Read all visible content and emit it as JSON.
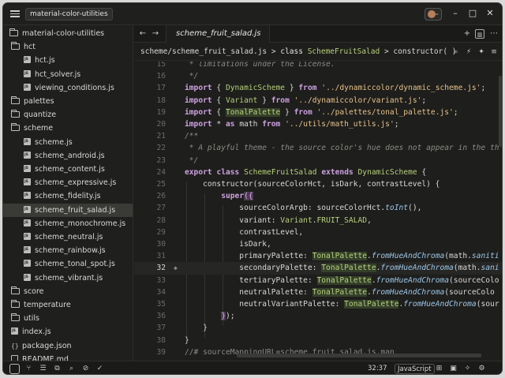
{
  "titlebar": {
    "project": "material-color-utilities",
    "controls": {
      "minimize": "–",
      "maximize": "□",
      "close": "✕"
    }
  },
  "sidebar": {
    "items": [
      {
        "label": "material-color-utilities",
        "kind": "folder-open",
        "depth": 0
      },
      {
        "label": "hct",
        "kind": "folder-open",
        "depth": 1
      },
      {
        "label": "hct.js",
        "kind": "js",
        "depth": 2
      },
      {
        "label": "hct_solver.js",
        "kind": "js",
        "depth": 2
      },
      {
        "label": "viewing_conditions.js",
        "kind": "js",
        "depth": 2
      },
      {
        "label": "palettes",
        "kind": "folder",
        "depth": 1
      },
      {
        "label": "quantize",
        "kind": "folder",
        "depth": 1
      },
      {
        "label": "scheme",
        "kind": "folder-open",
        "depth": 1
      },
      {
        "label": "scheme.js",
        "kind": "js",
        "depth": 2
      },
      {
        "label": "scheme_android.js",
        "kind": "js",
        "depth": 2
      },
      {
        "label": "scheme_content.js",
        "kind": "js",
        "depth": 2
      },
      {
        "label": "scheme_expressive.js",
        "kind": "js",
        "depth": 2
      },
      {
        "label": "scheme_fidelity.js",
        "kind": "js",
        "depth": 2
      },
      {
        "label": "scheme_fruit_salad.js",
        "kind": "js",
        "depth": 2,
        "selected": true
      },
      {
        "label": "scheme_monochrome.js",
        "kind": "js",
        "depth": 2
      },
      {
        "label": "scheme_neutral.js",
        "kind": "js",
        "depth": 2
      },
      {
        "label": "scheme_rainbow.js",
        "kind": "js",
        "depth": 2
      },
      {
        "label": "scheme_tonal_spot.js",
        "kind": "js",
        "depth": 2
      },
      {
        "label": "scheme_vibrant.js",
        "kind": "js",
        "depth": 2
      },
      {
        "label": "score",
        "kind": "folder",
        "depth": 1
      },
      {
        "label": "temperature",
        "kind": "folder",
        "depth": 1
      },
      {
        "label": "utils",
        "kind": "folder",
        "depth": 1
      },
      {
        "label": "index.js",
        "kind": "js",
        "depth": 1
      },
      {
        "label": "package.json",
        "kind": "json",
        "depth": 1
      },
      {
        "label": "README.md",
        "kind": "md",
        "depth": 1
      }
    ]
  },
  "editor": {
    "tab": "scheme_fruit_salad.js",
    "breadcrumb": {
      "path": "scheme/scheme_fruit_salad.js",
      "sep": ">",
      "keyword": "class",
      "class_name": "SchemeFruitSalad",
      "member": "constructor( )"
    }
  },
  "code": {
    "active_line": 32,
    "lines": [
      {
        "n": "15",
        "tokens": [
          [
            "c",
            " * limitations under the License."
          ]
        ]
      },
      {
        "n": "16",
        "tokens": [
          [
            "c",
            " */"
          ]
        ]
      },
      {
        "n": "17",
        "tokens": [
          [
            "k",
            "import"
          ],
          [
            "p",
            " { "
          ],
          [
            "t",
            "DynamicScheme"
          ],
          [
            "p",
            " } "
          ],
          [
            "k",
            "from"
          ],
          [
            "p",
            " "
          ],
          [
            "s",
            "'../dynamiccolor/dynamic_scheme.js'"
          ],
          [
            "p",
            ";"
          ]
        ]
      },
      {
        "n": "18",
        "tokens": [
          [
            "k",
            "import"
          ],
          [
            "p",
            " { "
          ],
          [
            "t",
            "Variant"
          ],
          [
            "p",
            " } "
          ],
          [
            "k",
            "from"
          ],
          [
            "p",
            " "
          ],
          [
            "s",
            "'../dynamiccolor/variant.js'"
          ],
          [
            "p",
            ";"
          ]
        ]
      },
      {
        "n": "19",
        "tokens": [
          [
            "k",
            "import"
          ],
          [
            "p",
            " { "
          ],
          [
            "th",
            "TonalPalette"
          ],
          [
            "p",
            " } "
          ],
          [
            "k",
            "from"
          ],
          [
            "p",
            " "
          ],
          [
            "s",
            "'../palettes/tonal_palette.js'"
          ],
          [
            "p",
            ";"
          ]
        ]
      },
      {
        "n": "20",
        "tokens": [
          [
            "k",
            "import"
          ],
          [
            "p",
            " * "
          ],
          [
            "k",
            "as"
          ],
          [
            "p",
            " math "
          ],
          [
            "k",
            "from"
          ],
          [
            "p",
            " "
          ],
          [
            "s",
            "'../utils/math_utils.js'"
          ],
          [
            "p",
            ";"
          ]
        ]
      },
      {
        "n": "21",
        "tokens": [
          [
            "c",
            "/**"
          ]
        ]
      },
      {
        "n": "22",
        "tokens": [
          [
            "c",
            " * A playful theme - the source color's hue does not appear in the th"
          ]
        ]
      },
      {
        "n": "23",
        "tokens": [
          [
            "c",
            " */"
          ]
        ]
      },
      {
        "n": "24",
        "tokens": [
          [
            "k",
            "export"
          ],
          [
            "p",
            " "
          ],
          [
            "k",
            "class"
          ],
          [
            "p",
            " "
          ],
          [
            "t",
            "SchemeFruitSalad"
          ],
          [
            "p",
            " "
          ],
          [
            "k",
            "extends"
          ],
          [
            "p",
            " "
          ],
          [
            "t",
            "DynamicScheme"
          ],
          [
            "p",
            " {"
          ]
        ]
      },
      {
        "n": "25",
        "tokens": [
          [
            "p",
            "    constructor(sourceColorHct, isDark, contrastLevel) {"
          ]
        ]
      },
      {
        "n": "26",
        "tokens": [
          [
            "p",
            "        "
          ],
          [
            "k",
            "super"
          ],
          [
            "br",
            "("
          ],
          [
            "br",
            "{"
          ]
        ]
      },
      {
        "n": "27",
        "tokens": [
          [
            "p",
            "            sourceColorArgb: sourceColorHct."
          ],
          [
            "f",
            "toInt"
          ],
          [
            "p",
            "(),"
          ]
        ]
      },
      {
        "n": "28",
        "tokens": [
          [
            "p",
            "            variant: "
          ],
          [
            "t",
            "Variant"
          ],
          [
            "p",
            "."
          ],
          [
            "t",
            "FRUIT_SALAD"
          ],
          [
            "p",
            ","
          ]
        ]
      },
      {
        "n": "29",
        "tokens": [
          [
            "p",
            "            contrastLevel,"
          ]
        ]
      },
      {
        "n": "30",
        "tokens": [
          [
            "p",
            "            isDark,"
          ]
        ]
      },
      {
        "n": "31",
        "tokens": [
          [
            "p",
            "            primaryPalette: "
          ],
          [
            "th",
            "TonalPalette"
          ],
          [
            "p",
            "."
          ],
          [
            "f",
            "fromHueAndChroma"
          ],
          [
            "p",
            "(math."
          ],
          [
            "f",
            "saniti"
          ]
        ]
      },
      {
        "n": "32",
        "tokens": [
          [
            "p",
            "            secondaryPalette: "
          ],
          [
            "th",
            "TonalPalette"
          ],
          [
            "p",
            "."
          ],
          [
            "f",
            "fromHueAndChroma"
          ],
          [
            "p",
            "(math."
          ],
          [
            "f",
            "sani"
          ]
        ]
      },
      {
        "n": "33",
        "tokens": [
          [
            "p",
            "            tertiaryPalette: "
          ],
          [
            "th",
            "TonalPalette"
          ],
          [
            "p",
            "."
          ],
          [
            "f",
            "fromHueAndChroma"
          ],
          [
            "p",
            "(sourceColo"
          ]
        ]
      },
      {
        "n": "34",
        "tokens": [
          [
            "p",
            "            neutralPalette: "
          ],
          [
            "th",
            "TonalPalette"
          ],
          [
            "p",
            "."
          ],
          [
            "f",
            "fromHueAndChroma"
          ],
          [
            "p",
            "(sourceColo"
          ]
        ]
      },
      {
        "n": "35",
        "tokens": [
          [
            "p",
            "            neutralVariantPalette: "
          ],
          [
            "th",
            "TonalPalette"
          ],
          [
            "p",
            "."
          ],
          [
            "f",
            "fromHueAndChroma"
          ],
          [
            "p",
            "(sour"
          ]
        ]
      },
      {
        "n": "36",
        "tokens": [
          [
            "p",
            "        "
          ],
          [
            "br",
            "}"
          ],
          [
            "p",
            ");"
          ]
        ]
      },
      {
        "n": "37",
        "tokens": [
          [
            "p",
            "    }"
          ]
        ]
      },
      {
        "n": "38",
        "tokens": [
          [
            "p",
            "}"
          ]
        ]
      },
      {
        "n": "39",
        "tokens": [
          [
            "tl",
            "//# sourceMappingURL=scheme_fruit_salad.js.map"
          ]
        ]
      }
    ]
  },
  "statusbar": {
    "cursor": "32:37",
    "language": "JavaScript"
  },
  "colors": {
    "background": "#1e1e1c",
    "keyword": "#cda1e0",
    "type": "#b6d07a",
    "string": "#e6c28a",
    "comment": "#8a8a86",
    "function": "#9cc7e8"
  }
}
